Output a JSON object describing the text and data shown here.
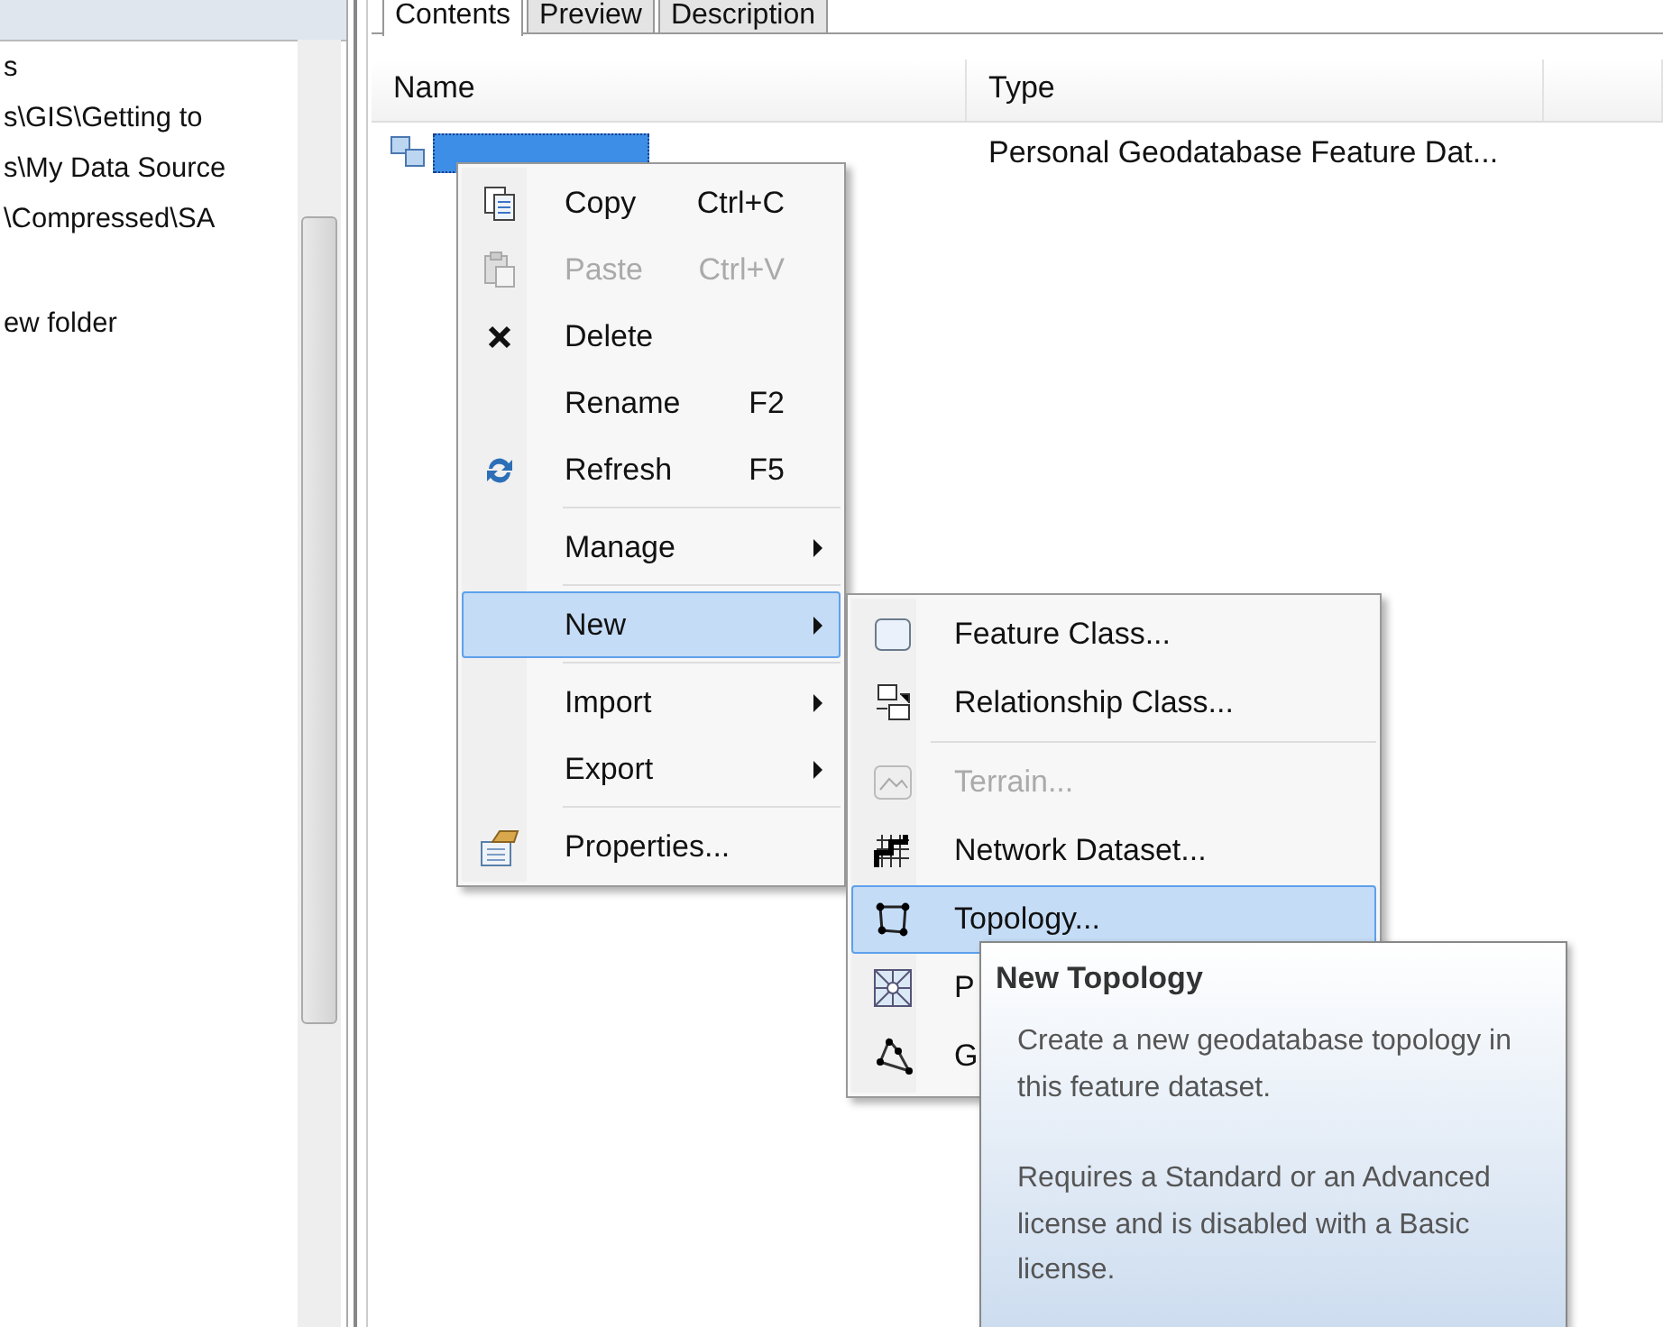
{
  "tree": {
    "items": [
      {
        "label": "s"
      },
      {
        "label": "s\\GIS\\Getting to"
      },
      {
        "label": "s\\My Data Source"
      },
      {
        "label": "\\Compressed\\SA"
      },
      {
        "label": "ew folder"
      }
    ]
  },
  "tabs": [
    {
      "label": "Contents",
      "selected": true
    },
    {
      "label": "Preview",
      "selected": false
    },
    {
      "label": "Description",
      "selected": false
    }
  ],
  "table": {
    "columns": [
      "Name",
      "Type"
    ],
    "rows": [
      {
        "type": "Personal Geodatabase Feature Dat...",
        "selected": true
      }
    ]
  },
  "context_menu": {
    "items": [
      {
        "kind": "item",
        "label": "Copy",
        "shortcut": "Ctrl+C",
        "disabled": false,
        "selected": false,
        "submenu": false
      },
      {
        "kind": "item",
        "label": "Paste",
        "shortcut": "Ctrl+V",
        "disabled": true,
        "selected": false,
        "submenu": false
      },
      {
        "kind": "item",
        "label": "Delete",
        "disabled": false,
        "selected": false,
        "submenu": false
      },
      {
        "kind": "item",
        "label": "Rename",
        "shortcut": "F2",
        "disabled": false,
        "selected": false,
        "submenu": false
      },
      {
        "kind": "item",
        "label": "Refresh",
        "shortcut": "F5",
        "disabled": false,
        "selected": false,
        "submenu": false
      },
      {
        "kind": "separator"
      },
      {
        "kind": "item",
        "label": "Manage",
        "disabled": false,
        "selected": false,
        "submenu": true
      },
      {
        "kind": "separator"
      },
      {
        "kind": "item",
        "label": "New",
        "disabled": false,
        "selected": true,
        "submenu": true
      },
      {
        "kind": "separator"
      },
      {
        "kind": "item",
        "label": "Import",
        "disabled": false,
        "selected": false,
        "submenu": true
      },
      {
        "kind": "item",
        "label": "Export",
        "disabled": false,
        "selected": false,
        "submenu": true
      },
      {
        "kind": "separator"
      },
      {
        "kind": "item",
        "label": "Properties...",
        "disabled": false,
        "selected": false,
        "submenu": false
      }
    ]
  },
  "submenu": {
    "items": [
      {
        "kind": "item",
        "label": "Feature Class...",
        "disabled": false,
        "selected": false
      },
      {
        "kind": "item",
        "label": "Relationship Class...",
        "disabled": false,
        "selected": false
      },
      {
        "kind": "separator"
      },
      {
        "kind": "item",
        "label": "Terrain...",
        "disabled": true,
        "selected": false
      },
      {
        "kind": "item",
        "label": "Network Dataset...",
        "disabled": false,
        "selected": false
      },
      {
        "kind": "item",
        "label": "Topology...",
        "disabled": false,
        "selected": true
      },
      {
        "kind": "item",
        "label": "P",
        "disabled": false,
        "selected": false
      },
      {
        "kind": "item",
        "label": "G",
        "disabled": false,
        "selected": false
      }
    ]
  },
  "tooltip": {
    "title": "New Topology",
    "paragraphs": [
      "Create a new geodatabase topology in this feature dataset.",
      "Requires a Standard or an Advanced license and is disabled with a Basic license."
    ]
  }
}
